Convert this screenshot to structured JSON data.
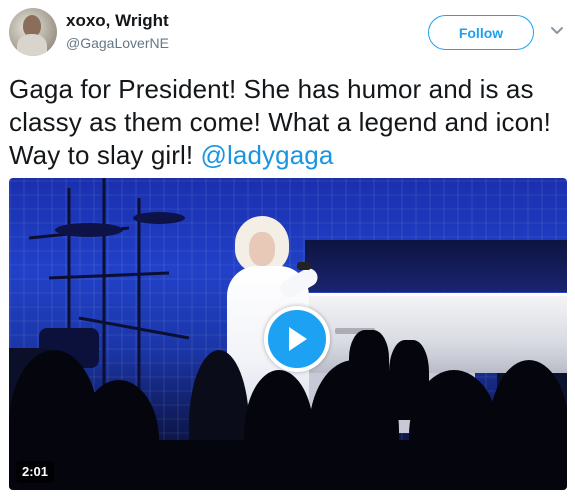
{
  "user": {
    "display_name": "xoxo, Wright",
    "handle": "@GagaLoverNE",
    "avatar_icon": "user-avatar"
  },
  "actions": {
    "follow_label": "Follow",
    "menu_icon": "chevron-down-icon"
  },
  "tweet": {
    "text": "Gaga for President! She has humor and is as classy as them come! What a legend and icon! Way to slay girl! ",
    "mention": "@ladygaga"
  },
  "video": {
    "duration": "2:01",
    "play_icon": "play-icon"
  },
  "colors": {
    "accent": "#1da1f2",
    "mention": "#1b95e0",
    "text": "#14171a",
    "secondary_text": "#657786"
  }
}
